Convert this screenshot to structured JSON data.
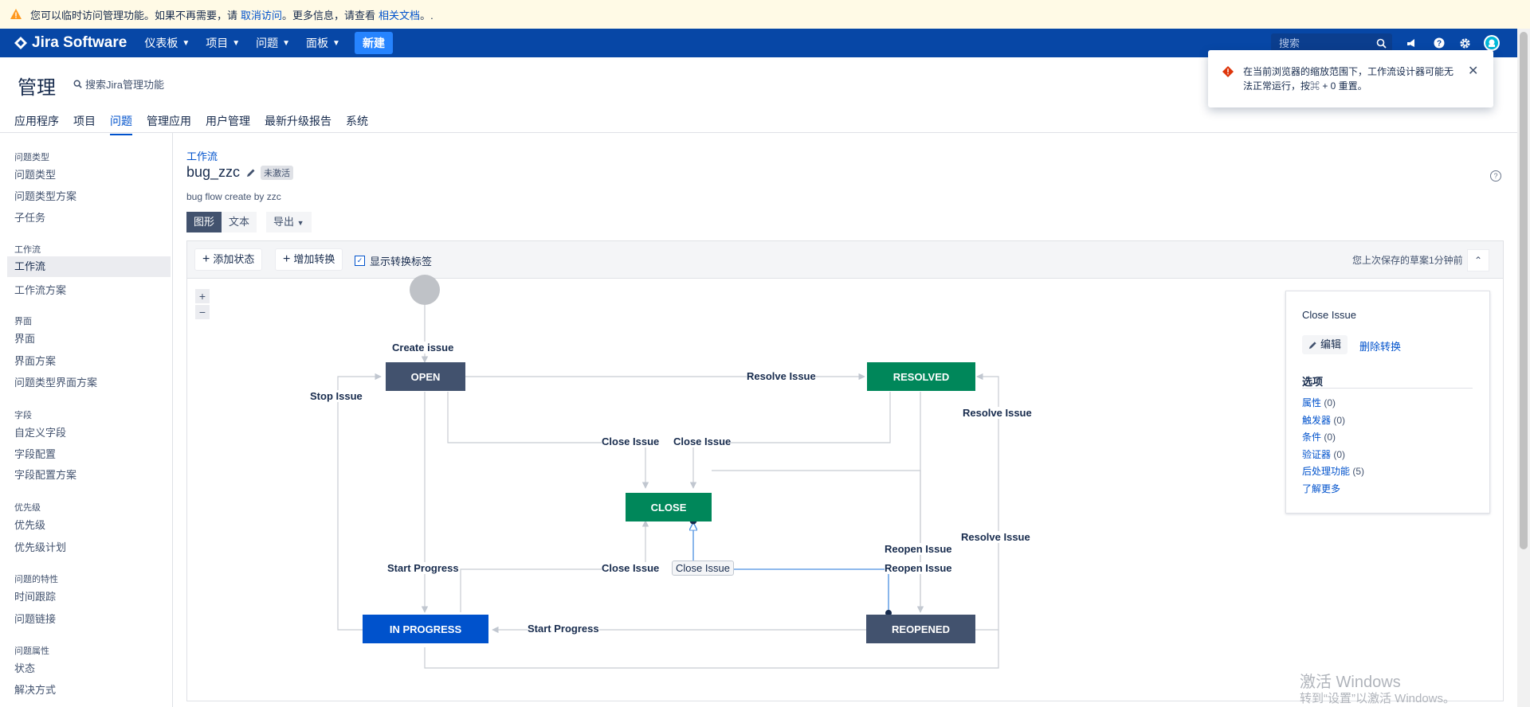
{
  "banner": {
    "text_before": "您可以临时访问管理功能。如果不再需要，请",
    "cancel_link": "取消访问",
    "text_middle": "。更多信息，请查看",
    "docs_link": "相关文档",
    "text_after": "。."
  },
  "topnav": {
    "logo": "Jira Software",
    "items": [
      {
        "label": "仪表板"
      },
      {
        "label": "项目"
      },
      {
        "label": "问题"
      },
      {
        "label": "面板"
      }
    ],
    "create_label": "新建",
    "search_placeholder": "搜索",
    "icons": [
      "notifications-icon",
      "help-icon",
      "settings-icon",
      "avatar"
    ]
  },
  "admin": {
    "title": "管理",
    "search_label": "搜索Jira管理功能",
    "tabs": [
      {
        "label": "应用程序",
        "active": false
      },
      {
        "label": "项目",
        "active": false
      },
      {
        "label": "问题",
        "active": true
      },
      {
        "label": "管理应用",
        "active": false
      },
      {
        "label": "用户管理",
        "active": false
      },
      {
        "label": "最新升级报告",
        "active": false
      },
      {
        "label": "系统",
        "active": false
      }
    ]
  },
  "sidebar": {
    "groups": [
      {
        "heading": "问题类型",
        "items": [
          "问题类型",
          "问题类型方案",
          "子任务"
        ]
      },
      {
        "heading": "工作流",
        "items": [
          "工作流",
          "工作流方案"
        ]
      },
      {
        "heading": "界面",
        "items": [
          "界面",
          "界面方案",
          "问题类型界面方案"
        ]
      },
      {
        "heading": "字段",
        "items": [
          "自定义字段",
          "字段配置",
          "字段配置方案"
        ]
      },
      {
        "heading": "优先级",
        "items": [
          "优先级",
          "优先级计划"
        ]
      },
      {
        "heading": "问题的特性",
        "items": [
          "时间跟踪",
          "问题链接"
        ]
      },
      {
        "heading": "问题属性",
        "items": [
          "状态",
          "解决方式"
        ]
      }
    ],
    "active_item": "工作流"
  },
  "workflow": {
    "breadcrumb": "工作流",
    "name": "bug_zzc",
    "status_badge": "未激活",
    "description": "bug flow create by zzc",
    "view_tabs": [
      {
        "label": "图形",
        "selected": true
      },
      {
        "label": "文本",
        "selected": false
      }
    ],
    "export_label": "导出"
  },
  "designer": {
    "add_status": "添加状态",
    "add_transition": "增加转换",
    "show_labels": "显示转换标签",
    "show_labels_checked": true,
    "saved_text": "您上次保存的草案1分钟前",
    "zoom_in": "+",
    "zoom_out": "−",
    "colors": {
      "todo": "#42526e",
      "done": "#00875a",
      "in_progress": "#0052cc",
      "selected_line": "#4a8fe0"
    },
    "statuses": {
      "open": "OPEN",
      "resolved": "RESOLVED",
      "close": "CLOSE",
      "in_progress": "IN PROGRESS",
      "reopened": "REOPENED"
    },
    "transitions": {
      "create": "Create issue",
      "resolve_open": "Resolve Issue",
      "stop": "Stop Issue",
      "close_from_open": "Close Issue",
      "close_from_resolved": "Close Issue",
      "resolve_reopened": "Resolve Issue",
      "resolve_inprogress": "Resolve Issue",
      "reopen_resolved": "Reopen Issue",
      "reopen_close": "Reopen Issue",
      "start_open": "Start Progress",
      "close_inprogress": "Close Issue",
      "close_reopened": "Close Issue",
      "start_reopened": "Start Progress"
    }
  },
  "panel": {
    "title": "Close Issue",
    "edit_label": "编辑",
    "delete_label": "删除转换",
    "options_heading": "选项",
    "options": [
      {
        "label": "属性",
        "count": "(0)"
      },
      {
        "label": "触发器",
        "count": "(0)"
      },
      {
        "label": "条件",
        "count": "(0)"
      },
      {
        "label": "验证器",
        "count": "(0)"
      },
      {
        "label": "后处理功能",
        "count": "(5)"
      },
      {
        "label": "了解更多",
        "count": ""
      }
    ]
  },
  "toast": {
    "text": "在当前浏览器的缩放范围下，工作流设计器可能无法正常运行，按⌘ + 0 重置。"
  },
  "watermark": {
    "line1": "激活 Windows",
    "line2": "转到“设置”以激活 Windows。"
  }
}
